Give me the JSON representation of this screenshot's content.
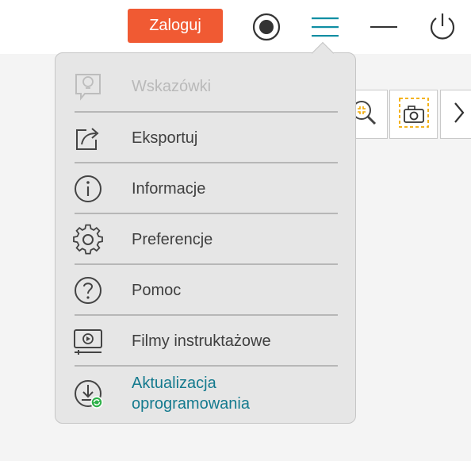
{
  "header": {
    "login_label": "Zaloguj",
    "accent_color": "#f05a33",
    "menu_icon_color": "#0f8ea3",
    "icons": [
      "record-icon",
      "hamburger-menu-icon",
      "minimize-icon",
      "power-icon"
    ]
  },
  "toolbar": {
    "icons": [
      "zoom-region-icon",
      "screenshot-capture-icon",
      "chevron-right-icon"
    ]
  },
  "menu": {
    "items": [
      {
        "label": "Wskazówki",
        "icon": "lightbulb-icon",
        "disabled": true
      },
      {
        "label": "Eksportuj",
        "icon": "export-icon"
      },
      {
        "label": "Informacje",
        "icon": "info-icon"
      },
      {
        "label": "Preferencje",
        "icon": "gear-icon"
      },
      {
        "label": "Pomoc",
        "icon": "help-icon"
      },
      {
        "label": "Filmy instruktażowe",
        "icon": "video-tutorial-icon"
      },
      {
        "label": "Aktualizacja oprogramowania",
        "icon": "software-update-icon",
        "highlight_color": "#147a8e"
      }
    ]
  }
}
